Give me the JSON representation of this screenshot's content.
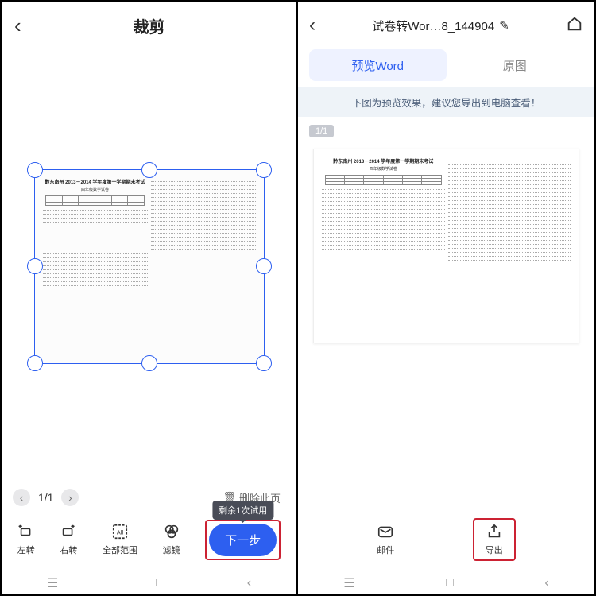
{
  "left": {
    "title": "裁剪",
    "page_indicator": "1/1",
    "delete_page": "删除此页",
    "tools": {
      "rotate_left": "左转",
      "rotate_right": "右转",
      "full_range": "全部范围",
      "filter": "滤镜"
    },
    "next_button": "下一步",
    "tooltip": "剩余1次试用",
    "doc": {
      "heading": "黔东南州 2013－2014 学年度第一学期期末考试",
      "subtitle": "四年级数学试卷"
    }
  },
  "right": {
    "title": "试卷转Wor…8_144904",
    "tabs": {
      "preview": "预览Word",
      "original": "原图"
    },
    "banner": "下图为预览效果，建议您导出到电脑查看！",
    "page_badge": "1/1",
    "tools": {
      "mail": "邮件",
      "export": "导出"
    }
  }
}
